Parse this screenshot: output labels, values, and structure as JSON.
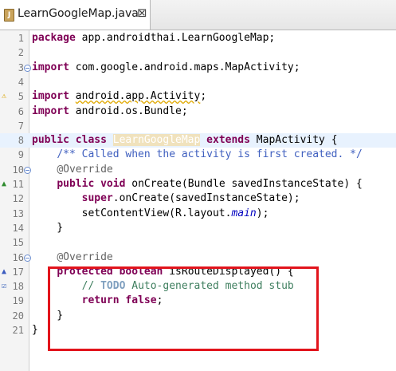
{
  "tab": {
    "title": "LearnGoogleMap.java",
    "close": "⊠",
    "icon_label": "J"
  },
  "lines": [
    {
      "n": "1",
      "parts": [
        {
          "t": "package",
          "c": "k"
        },
        {
          "t": " app.androidthai.LearnGoogleMap;"
        }
      ]
    },
    {
      "n": "2",
      "parts": []
    },
    {
      "n": "3",
      "parts": [
        {
          "t": "import",
          "c": "k"
        },
        {
          "t": " com.google.android.maps.MapActivity;"
        }
      ]
    },
    {
      "n": "4",
      "parts": []
    },
    {
      "n": "5",
      "parts": [
        {
          "t": "import",
          "c": "k"
        },
        {
          "t": " "
        },
        {
          "t": "android.app.Activity",
          "c": "warn"
        },
        {
          "t": ";"
        }
      ]
    },
    {
      "n": "6",
      "parts": [
        {
          "t": "import",
          "c": "k"
        },
        {
          "t": " android.os.Bundle;"
        }
      ]
    },
    {
      "n": "7",
      "parts": []
    },
    {
      "n": "8",
      "parts": [
        {
          "t": "public",
          "c": "k"
        },
        {
          "t": " "
        },
        {
          "t": "class",
          "c": "k"
        },
        {
          "t": " "
        },
        {
          "t": "LearnGoogleMap",
          "c": "occ"
        },
        {
          "t": " "
        },
        {
          "t": "extends",
          "c": "k"
        },
        {
          "t": " MapActivity {"
        }
      ]
    },
    {
      "n": "9",
      "parts": [
        {
          "t": "    "
        },
        {
          "t": "/** Called when the activity is first created. */",
          "c": "jd"
        }
      ]
    },
    {
      "n": "10",
      "parts": [
        {
          "t": "    "
        },
        {
          "t": "@Override",
          "c": "an"
        }
      ]
    },
    {
      "n": "11",
      "parts": [
        {
          "t": "    "
        },
        {
          "t": "public",
          "c": "k"
        },
        {
          "t": " "
        },
        {
          "t": "void",
          "c": "k"
        },
        {
          "t": " onCreate(Bundle savedInstanceState) {"
        }
      ]
    },
    {
      "n": "12",
      "parts": [
        {
          "t": "        "
        },
        {
          "t": "super",
          "c": "k"
        },
        {
          "t": ".onCreate(savedInstanceState);"
        }
      ]
    },
    {
      "n": "13",
      "parts": [
        {
          "t": "        setContentView(R.layout."
        },
        {
          "t": "main",
          "c": "it"
        },
        {
          "t": ");"
        }
      ]
    },
    {
      "n": "14",
      "parts": [
        {
          "t": "    }"
        }
      ]
    },
    {
      "n": "15",
      "parts": []
    },
    {
      "n": "16",
      "parts": [
        {
          "t": "    "
        },
        {
          "t": "@Override",
          "c": "an"
        }
      ]
    },
    {
      "n": "17",
      "parts": [
        {
          "t": "    "
        },
        {
          "t": "protected",
          "c": "k"
        },
        {
          "t": " "
        },
        {
          "t": "boolean",
          "c": "k"
        },
        {
          "t": " isRouteDisplayed() {"
        }
      ]
    },
    {
      "n": "18",
      "parts": [
        {
          "t": "        "
        },
        {
          "t": "// ",
          "c": "cm"
        },
        {
          "t": "TODO",
          "c": "todo"
        },
        {
          "t": " Auto-generated method stub",
          "c": "cm"
        }
      ]
    },
    {
      "n": "19",
      "parts": [
        {
          "t": "        "
        },
        {
          "t": "return",
          "c": "k"
        },
        {
          "t": " "
        },
        {
          "t": "false",
          "c": "k"
        },
        {
          "t": ";"
        }
      ]
    },
    {
      "n": "20",
      "parts": [
        {
          "t": "    }"
        }
      ]
    },
    {
      "n": "21",
      "parts": [
        {
          "t": "}"
        }
      ]
    }
  ],
  "markers": {
    "fold_lines": [
      "3",
      "10",
      "16"
    ],
    "warning_line": "5",
    "override_lines": [
      "11",
      "17"
    ],
    "task_line": "18"
  },
  "colors": {
    "keyword": "#7f0055",
    "comment": "#3f7f5f",
    "javadoc": "#3f5fbf",
    "highlight_box": "#e2141c",
    "current_line": "#e8f2fe"
  }
}
